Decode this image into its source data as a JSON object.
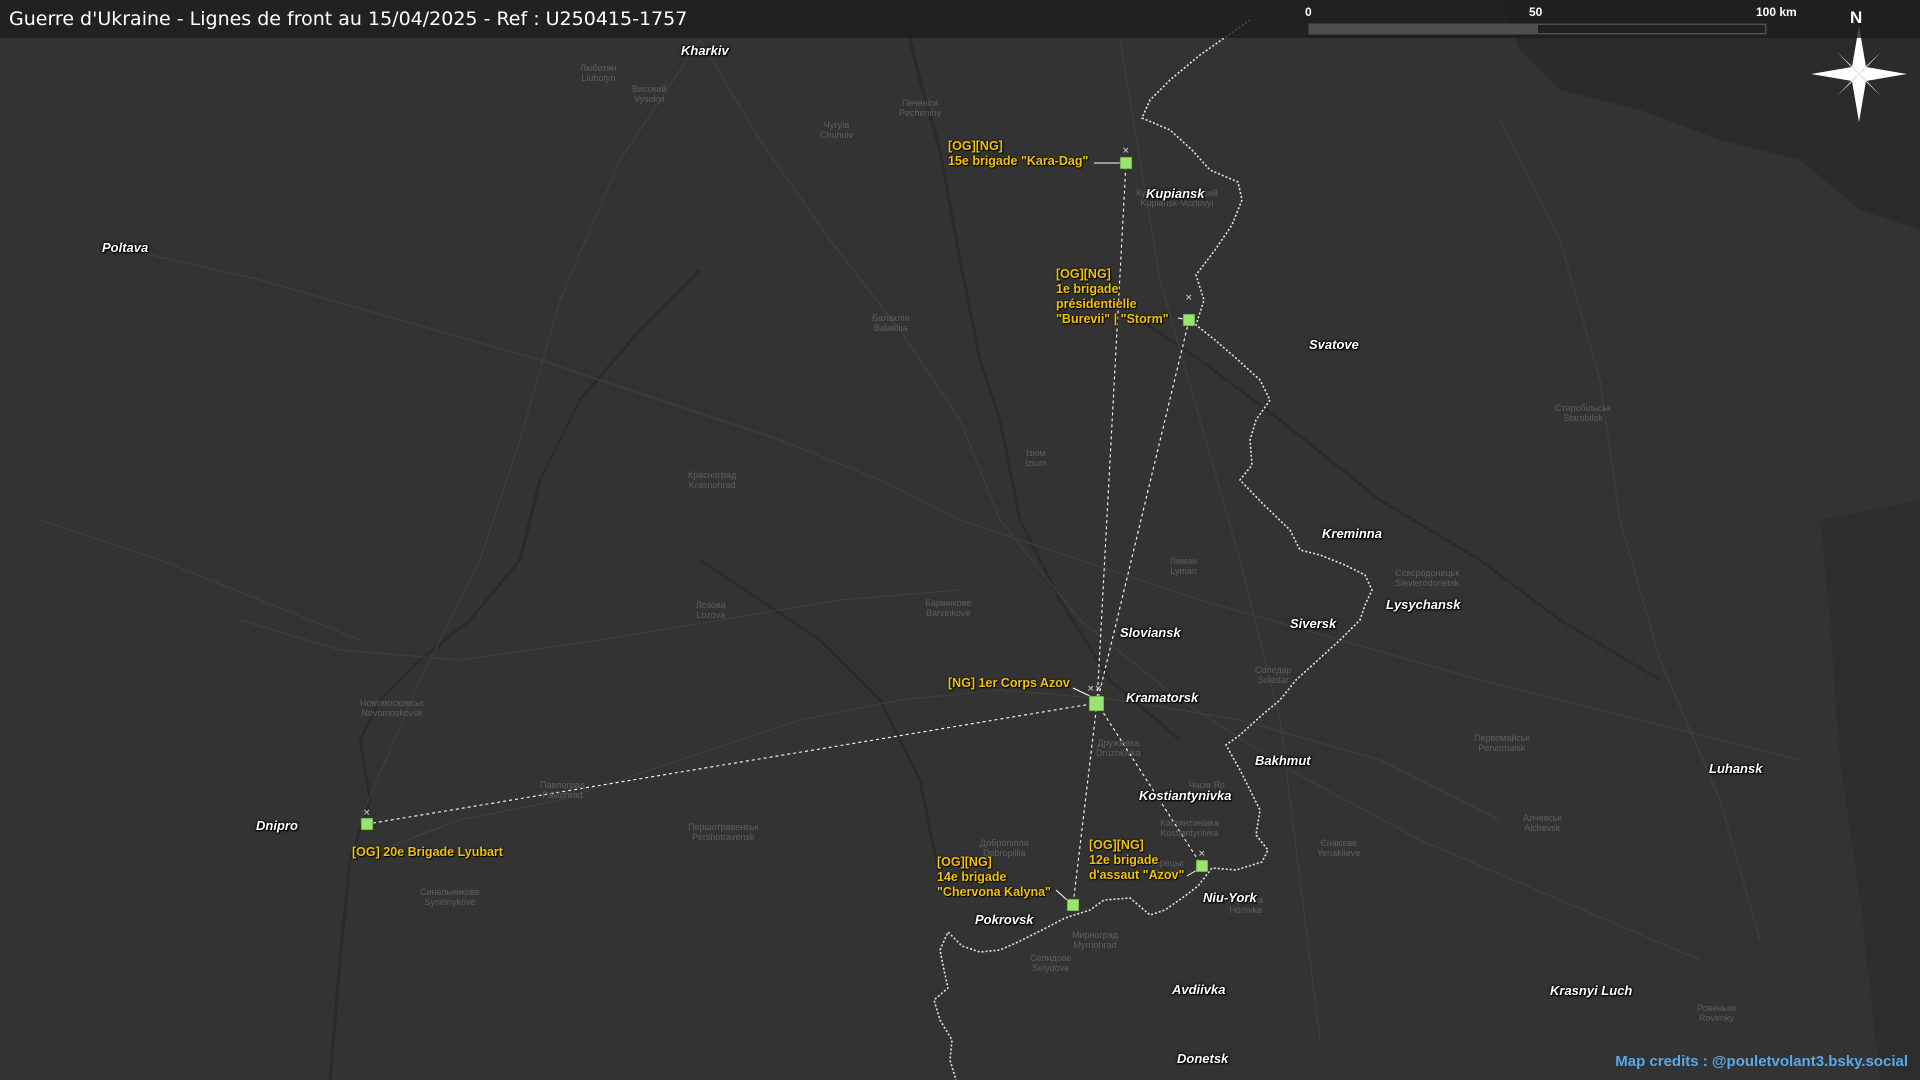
{
  "title": "Guerre d'Ukraine - Lignes de front au 15/04/2025 - Ref : U250415-1757",
  "scale_bar": {
    "labels": [
      "0",
      "50",
      "100 km"
    ]
  },
  "north_arrow": {
    "label": "N"
  },
  "credits": "Map credits : @pouletvolant3.bsky.social",
  "colors": {
    "background": "#333333",
    "front_line": "#e6e6e6",
    "unit_marker": "#9be26e",
    "unit_label": "#f2c200",
    "credits": "#5aa8e6",
    "connector": "#ffffff"
  },
  "cities": [
    {
      "id": "kharkiv",
      "name": "Kharkiv"
    },
    {
      "id": "poltava",
      "name": "Poltava"
    },
    {
      "id": "kupiansk",
      "name": "Kupiansk"
    },
    {
      "id": "svatove",
      "name": "Svatove"
    },
    {
      "id": "kreminna",
      "name": "Kreminna"
    },
    {
      "id": "lysychansk",
      "name": "Lysychansk"
    },
    {
      "id": "siversk",
      "name": "Siversk"
    },
    {
      "id": "sloviansk",
      "name": "Sloviansk"
    },
    {
      "id": "kramatorsk",
      "name": "Kramatorsk"
    },
    {
      "id": "bakhmut",
      "name": "Bakhmut"
    },
    {
      "id": "kostiantynivka",
      "name": "Kostiantynivka"
    },
    {
      "id": "dnipro",
      "name": "Dnipro"
    },
    {
      "id": "pokrovsk",
      "name": "Pokrovsk"
    },
    {
      "id": "niu-york",
      "name": "Niu-York"
    },
    {
      "id": "avdiivka",
      "name": "Avdiivka"
    },
    {
      "id": "donetsk",
      "name": "Donetsk"
    },
    {
      "id": "luhansk",
      "name": "Luhansk"
    },
    {
      "id": "krasnyi-luch",
      "name": "Krasnyi Luch"
    }
  ],
  "minor_places": [
    {
      "id": "ljubotyn",
      "name": "Люботин\nLiubotyn"
    },
    {
      "id": "vysokyi",
      "name": "Високий\nVysokyi"
    },
    {
      "id": "chuhuiv",
      "name": "Чугуїв\nChuhuiv"
    },
    {
      "id": "pechenihy",
      "name": "Печеніги\nPechenihy"
    },
    {
      "id": "balakliia",
      "name": "Балаклія\nBalakliia"
    },
    {
      "id": "izium",
      "name": "Ізюм\nIzium"
    },
    {
      "id": "krasnohrad",
      "name": "Красноград\nKrasnohrad"
    },
    {
      "id": "lozova",
      "name": "Лозова\nLozova"
    },
    {
      "id": "barvinkove",
      "name": "Барвінкове\nBarvinkove"
    },
    {
      "id": "pavlohrad",
      "name": "Павлоград\nPavlohrad"
    },
    {
      "id": "novomoskovsk",
      "name": "Новомосковськ\nNovomoskovsk"
    },
    {
      "id": "starobilsk",
      "name": "Старобільськ\nStarobilsk"
    },
    {
      "id": "sieverodonetsk",
      "name": "Сєвєродонецьк\nSievierodonetsk"
    },
    {
      "id": "horlivka",
      "name": "Горлівка\nHorlivka"
    },
    {
      "id": "druzhkivka",
      "name": "Дружківка\nDruzhkivka"
    },
    {
      "id": "dobropillia",
      "name": "Добропілля\nDobropillia"
    },
    {
      "id": "selydove",
      "name": "Селидове\nSelydove"
    },
    {
      "id": "myrnohrad",
      "name": "Мирноград\nMyrnohrad"
    },
    {
      "id": "rovenky",
      "name": "Ровеньки\nRovenky"
    },
    {
      "id": "alchevsk",
      "name": "Алчевськ\nAlchevsk"
    },
    {
      "id": "pervomaisk",
      "name": "Первомайськ\nPervomaisk"
    },
    {
      "id": "synelnykove",
      "name": "Синельникове\nSynelnykove"
    },
    {
      "id": "pershotravensk",
      "name": "Першотравенськ\nPershotravensk"
    },
    {
      "id": "kupiansk-vuzlovyi",
      "name": "Куп'янськ-Вузловий\nKupiansk-Vuzlovyi"
    },
    {
      "id": "lyman",
      "name": "Лиман\nLyman"
    },
    {
      "id": "kakhovka-soledar",
      "name": "Соледар\nSoledar"
    },
    {
      "id": "toretsk",
      "name": "Торецьк\nToretsk"
    },
    {
      "id": "chasiv-yar",
      "name": "Часів Яр\nChasiv Yar"
    },
    {
      "id": "kostiantynivka-minor",
      "name": "Костянтинівка\nKostiantynivka"
    },
    {
      "id": "yenakiieve",
      "name": "Єнакієве\nYenakiieve"
    }
  ],
  "units": [
    {
      "id": "kara-dag",
      "lines": [
        "[OG][NG]",
        "15e brigade \"Kara-Dag\""
      ]
    },
    {
      "id": "burevii",
      "lines": [
        "[OG][NG]",
        "1e brigade",
        "présidentielle",
        "\"Burevii\" | \"Storm\""
      ]
    },
    {
      "id": "azov-corps",
      "lines": [
        "[NG] 1er Corps Azov"
      ]
    },
    {
      "id": "lyubart",
      "lines": [
        "[OG] 20e Brigade Lyubart"
      ]
    },
    {
      "id": "chervona-kalyna",
      "lines": [
        "[OG][NG]",
        "14e brigade",
        "\"Chervona Kalyna\""
      ]
    },
    {
      "id": "azov-12",
      "lines": [
        "[OG][NG]",
        "12e brigade",
        "d'assaut \"Azov\""
      ]
    }
  ]
}
